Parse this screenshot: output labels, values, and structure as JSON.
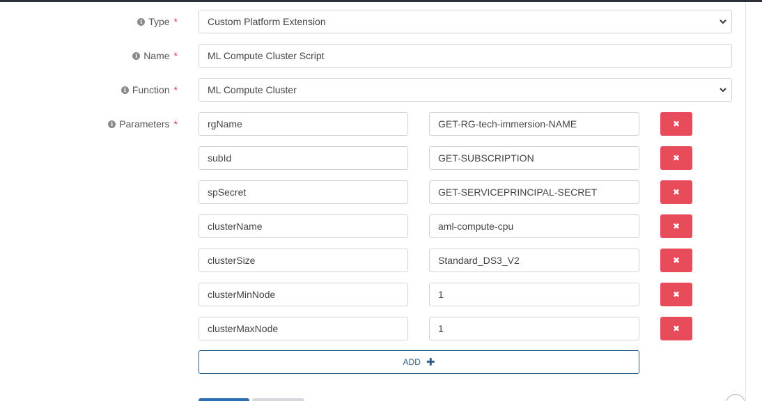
{
  "form": {
    "type": {
      "label": "Type",
      "required_mark": "*",
      "value": "Custom Platform Extension"
    },
    "name": {
      "label": "Name",
      "required_mark": "*",
      "value": "ML Compute Cluster Script"
    },
    "function": {
      "label": "Function",
      "required_mark": "*",
      "value": "ML Compute Cluster"
    },
    "parameters": {
      "label": "Parameters",
      "required_mark": "*",
      "rows": [
        {
          "key": "rgName",
          "value": "GET-RG-tech-immersion-NAME"
        },
        {
          "key": "subId",
          "value": "GET-SUBSCRIPTION"
        },
        {
          "key": "spSecret",
          "value": "GET-SERVICEPRINCIPAL-SECRET"
        },
        {
          "key": "clusterName",
          "value": "aml-compute-cpu"
        },
        {
          "key": "clusterSize",
          "value": "Standard_DS3_V2"
        },
        {
          "key": "clusterMinNode",
          "value": "1"
        },
        {
          "key": "clusterMaxNode",
          "value": "1"
        }
      ],
      "remove_icon": "times-icon"
    },
    "add_button": {
      "label": "ADD",
      "icon": "plus-icon"
    }
  },
  "colors": {
    "danger": "#e84c5a",
    "primary": "#2f5d8a",
    "required": "#e0364a"
  }
}
